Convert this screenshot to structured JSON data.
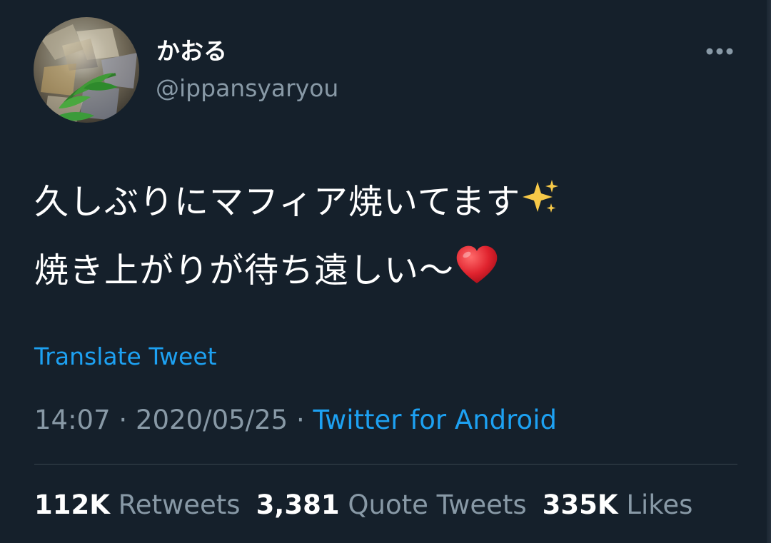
{
  "colors": {
    "background": "#15202b",
    "text_primary": "#ffffff",
    "text_secondary": "#8899a6",
    "link": "#1da1f2",
    "divider": "#38444d"
  },
  "user": {
    "display_name": "かおる",
    "handle": "@ippansyaryou",
    "avatar_icon": "profile-avatar-foil-leaf"
  },
  "menu": {
    "icon": "more-horizontal-icon"
  },
  "tweet": {
    "lines": [
      "久しぶりにマフィア焼いてます",
      "焼き上がりが待ち遠しい〜"
    ],
    "emoji": [
      "sparkles",
      "red-heart"
    ]
  },
  "translate_label": "Translate Tweet",
  "meta": {
    "time": "14:07",
    "separator": " · ",
    "date": "2020/05/25",
    "source": "Twitter for Android"
  },
  "stats": [
    {
      "count": "112K",
      "label": "Retweets"
    },
    {
      "count": "3,381",
      "label": "Quote Tweets"
    },
    {
      "count": "335K",
      "label": "Likes"
    }
  ]
}
